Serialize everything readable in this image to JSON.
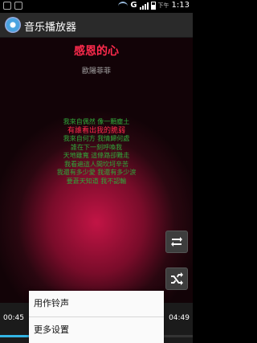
{
  "status_bar": {
    "carrier": "G",
    "time": "1:13",
    "ampm": "下午"
  },
  "app": {
    "title": "音乐播放器"
  },
  "song": {
    "title": "感恩的心",
    "artist": "歐陽菲菲"
  },
  "lyrics": [
    "我來自偶然 像一顆塵土",
    "有誰看出我的脆弱",
    "我來自何方 我情歸何處",
    "誰在下一刻呼喚我",
    "天地雖寬 這條路卻難走",
    "我看遍這人間坎坷辛苦",
    "我還有多少愛 我還有多少淚",
    "要蒼天知道 我不認輸"
  ],
  "current_lyric_index": 1,
  "player": {
    "elapsed": "00:45",
    "total": "04:49",
    "progress": 0.156
  },
  "context_menu": {
    "items": [
      "用作铃声",
      "更多设置"
    ]
  }
}
